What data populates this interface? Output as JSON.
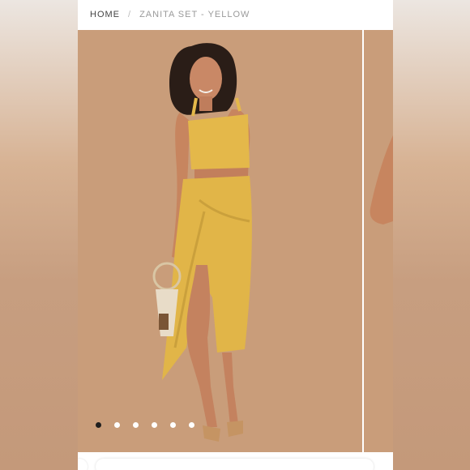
{
  "breadcrumb": {
    "home": "HOME",
    "separator": "/",
    "current": "ZANITA SET - YELLOW"
  },
  "gallery": {
    "total_slides": 6,
    "active_index": 0,
    "main_image_icon": "model-photo",
    "next_image_icon": "model-photo-partial"
  },
  "colors": {
    "backdrop": "#c99d7a",
    "dress": "#e3b84a",
    "dot_active": "#1e1e1e",
    "dot_inactive": "#ffffff"
  }
}
